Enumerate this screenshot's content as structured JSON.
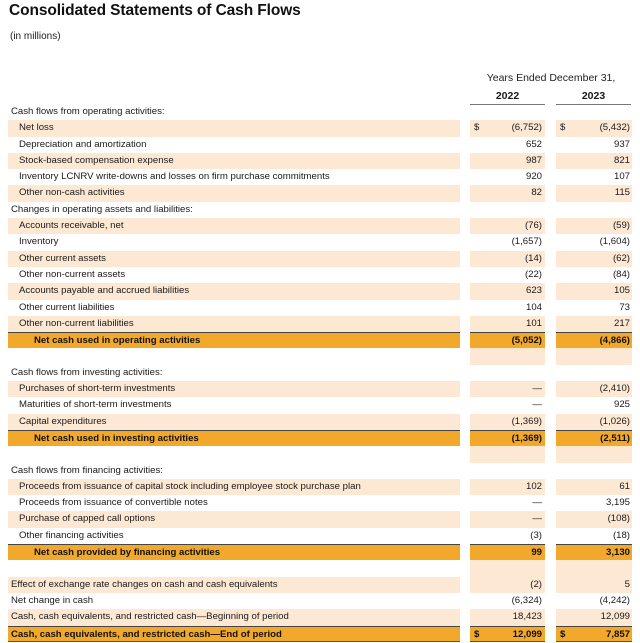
{
  "header": {
    "title": "Consolidated Statements of Cash Flows",
    "units": "(in millions)",
    "period_group": "Years Ended December 31,",
    "years": [
      "2022",
      "2023"
    ]
  },
  "colors": {
    "row_shade": "#fde8d3",
    "subtotal": "#f2a82a"
  },
  "rows": [
    {
      "type": "section",
      "label": "Cash flows from operating activities:",
      "v2022": "",
      "v2023": ""
    },
    {
      "type": "item",
      "label": "Net loss",
      "cur": "$",
      "v2022": "(6,752)",
      "v2023": "(5,432)"
    },
    {
      "type": "item",
      "label": "Depreciation and amortization",
      "v2022": "652",
      "v2023": "937"
    },
    {
      "type": "item",
      "label": "Stock-based compensation expense",
      "v2022": "987",
      "v2023": "821"
    },
    {
      "type": "item",
      "label": "Inventory LCNRV write-downs and losses on firm purchase commitments",
      "v2022": "920",
      "v2023": "107"
    },
    {
      "type": "item",
      "label": "Other non-cash activities",
      "v2022": "82",
      "v2023": "115"
    },
    {
      "type": "section",
      "label": "Changes in operating assets and liabilities:",
      "v2022": "",
      "v2023": ""
    },
    {
      "type": "item",
      "label": "Accounts receivable, net",
      "v2022": "(76)",
      "v2023": "(59)"
    },
    {
      "type": "item",
      "label": "Inventory",
      "v2022": "(1,657)",
      "v2023": "(1,604)"
    },
    {
      "type": "item",
      "label": "Other current assets",
      "v2022": "(14)",
      "v2023": "(62)"
    },
    {
      "type": "item",
      "label": "Other non-current assets",
      "v2022": "(22)",
      "v2023": "(84)"
    },
    {
      "type": "item",
      "label": "Accounts payable and accrued liabilities",
      "v2022": "623",
      "v2023": "105"
    },
    {
      "type": "item",
      "label": "Other current liabilities",
      "v2022": "104",
      "v2023": "73"
    },
    {
      "type": "item",
      "label": "Other non-current liabilities",
      "v2022": "101",
      "v2023": "217"
    },
    {
      "type": "total",
      "label": "Net cash used in operating activities",
      "v2022": "(5,052)",
      "v2023": "(4,866)"
    },
    {
      "type": "spacer",
      "label": "",
      "v2022": "",
      "v2023": ""
    },
    {
      "type": "section",
      "label": "Cash flows from investing activities:",
      "v2022": "",
      "v2023": ""
    },
    {
      "type": "item",
      "label": "Purchases of short-term investments",
      "v2022": "—",
      "v2023": "(2,410)"
    },
    {
      "type": "item",
      "label": "Maturities of short-term investments",
      "v2022": "—",
      "v2023": "925"
    },
    {
      "type": "item",
      "label": "Capital expenditures",
      "v2022": "(1,369)",
      "v2023": "(1,026)"
    },
    {
      "type": "total",
      "label": "Net cash used in investing activities",
      "v2022": "(1,369)",
      "v2023": "(2,511)"
    },
    {
      "type": "spacer",
      "label": "",
      "v2022": "",
      "v2023": ""
    },
    {
      "type": "section",
      "label": "Cash flows from financing activities:",
      "v2022": "",
      "v2023": ""
    },
    {
      "type": "item",
      "label": "Proceeds from issuance of capital stock including employee stock purchase plan",
      "v2022": "102",
      "v2023": "61"
    },
    {
      "type": "item",
      "label": "Proceeds from issuance of convertible notes",
      "v2022": "—",
      "v2023": "3,195"
    },
    {
      "type": "item",
      "label": "Purchase of capped call options",
      "v2022": "—",
      "v2023": "(108)"
    },
    {
      "type": "item",
      "label": "Other financing activities",
      "v2022": "(3)",
      "v2023": "(18)"
    },
    {
      "type": "total",
      "label": "Net cash provided by financing activities",
      "v2022": "99",
      "v2023": "3,130"
    },
    {
      "type": "spacer",
      "label": "",
      "v2022": "",
      "v2023": ""
    },
    {
      "type": "plain",
      "label": "Effect of exchange rate changes on cash and cash equivalents",
      "v2022": "(2)",
      "v2023": "5"
    },
    {
      "type": "plain",
      "label": "Net change in cash",
      "v2022": "(6,324)",
      "v2023": "(4,242)"
    },
    {
      "type": "plain",
      "label": "Cash, cash equivalents, and restricted cash—Beginning of period",
      "v2022": "18,423",
      "v2023": "12,099"
    },
    {
      "type": "grand",
      "label": "Cash, cash equivalents, and restricted cash—End of period",
      "cur": "$",
      "v2022": "12,099",
      "v2023": "7,857"
    }
  ]
}
